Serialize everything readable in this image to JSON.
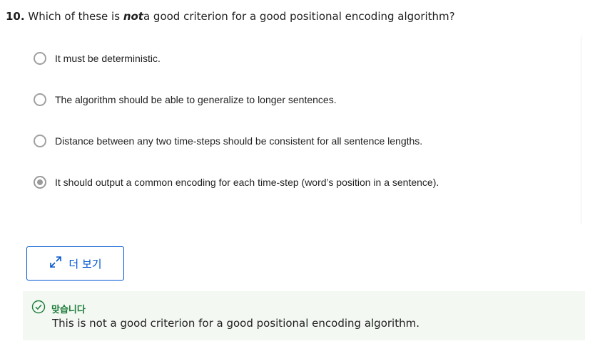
{
  "question": {
    "number": "10.",
    "text_before": "Which of these is",
    "emphasis": "not",
    "text_after": "a good criterion for a good positional encoding algorithm?"
  },
  "options": [
    {
      "label": "It must be deterministic.",
      "selected": false
    },
    {
      "label": "The algorithm should be able to generalize to longer sentences.",
      "selected": false
    },
    {
      "label": "Distance between any two time-steps should be consistent for all sentence lengths.",
      "selected": false
    },
    {
      "label": "It should output a common encoding for each time-step (word’s position in a sentence).",
      "selected": true
    }
  ],
  "more_button": {
    "label": "더 보기",
    "icon": "expand-icon"
  },
  "feedback": {
    "status": "맞습니다",
    "icon": "check-circle-icon",
    "message": "This is not a good criterion for a good positional encoding algorithm.",
    "color": "#1d7c3a",
    "background": "#f3f8f2"
  },
  "colors": {
    "accent": "#0056d2",
    "radio_border": "#a0a0a0"
  }
}
